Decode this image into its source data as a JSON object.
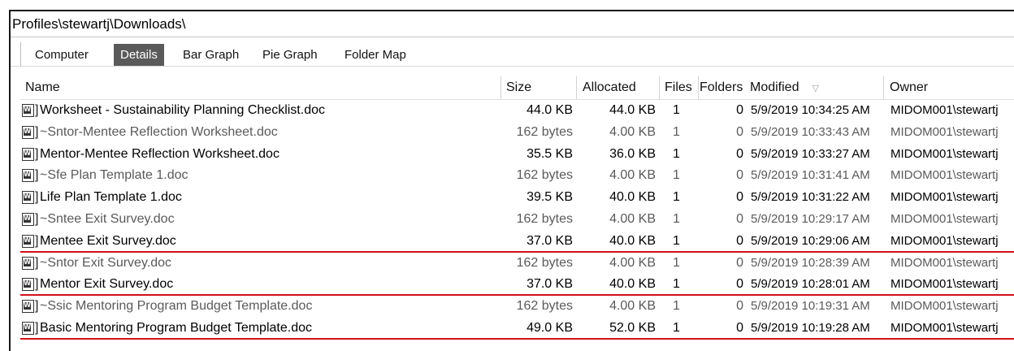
{
  "path": "Profiles\\stewartj\\Downloads\\",
  "tabs": [
    {
      "label": "Computer",
      "active": false
    },
    {
      "label": "Details",
      "active": true
    },
    {
      "label": "Bar Graph",
      "active": false
    },
    {
      "label": "Pie Graph",
      "active": false
    },
    {
      "label": "Folder Map",
      "active": false
    }
  ],
  "columns": {
    "name": "Name",
    "size": "Size",
    "allocated": "Allocated",
    "files": "Files",
    "folders": "Folders",
    "modified": "Modified",
    "owner": "Owner"
  },
  "sort_indicator": "▽",
  "rows": [
    {
      "name": "Worksheet - Sustainability Planning Checklist.doc",
      "size": "44.0 KB",
      "allocated": "44.0 KB",
      "files": "1",
      "folders": "0",
      "modified": "5/9/2019 10:34:25 AM",
      "owner": "MIDOM001\\stewartj",
      "temp": false
    },
    {
      "name": "~Sntor-Mentee Reflection Worksheet.doc",
      "size": "162 bytes",
      "allocated": "4.00 KB",
      "files": "1",
      "folders": "0",
      "modified": "5/9/2019 10:33:43 AM",
      "owner": "MIDOM001\\stewartj",
      "temp": true
    },
    {
      "name": "Mentor-Mentee Reflection Worksheet.doc",
      "size": "35.5 KB",
      "allocated": "36.0 KB",
      "files": "1",
      "folders": "0",
      "modified": "5/9/2019 10:33:27 AM",
      "owner": "MIDOM001\\stewartj",
      "temp": false
    },
    {
      "name": "~Sfe Plan Template 1.doc",
      "size": "162 bytes",
      "allocated": "4.00 KB",
      "files": "1",
      "folders": "0",
      "modified": "5/9/2019 10:31:41 AM",
      "owner": "MIDOM001\\stewartj",
      "temp": true
    },
    {
      "name": "Life Plan Template 1.doc",
      "size": "39.5 KB",
      "allocated": "40.0 KB",
      "files": "1",
      "folders": "0",
      "modified": "5/9/2019 10:31:22 AM",
      "owner": "MIDOM001\\stewartj",
      "temp": false
    },
    {
      "name": "~Sntee Exit Survey.doc",
      "size": "162 bytes",
      "allocated": "4.00 KB",
      "files": "1",
      "folders": "0",
      "modified": "5/9/2019 10:29:17 AM",
      "owner": "MIDOM001\\stewartj",
      "temp": true
    },
    {
      "name": "Mentee Exit Survey.doc",
      "size": "37.0 KB",
      "allocated": "40.0 KB",
      "files": "1",
      "folders": "0",
      "modified": "5/9/2019 10:29:06 AM",
      "owner": "MIDOM001\\stewartj",
      "temp": false
    },
    {
      "name": "~Sntor Exit Survey.doc",
      "size": "162 bytes",
      "allocated": "4.00 KB",
      "files": "1",
      "folders": "0",
      "modified": "5/9/2019 10:28:39 AM",
      "owner": "MIDOM001\\stewartj",
      "temp": true
    },
    {
      "name": "Mentor Exit Survey.doc",
      "size": "37.0 KB",
      "allocated": "40.0 KB",
      "files": "1",
      "folders": "0",
      "modified": "5/9/2019 10:28:01 AM",
      "owner": "MIDOM001\\stewartj",
      "temp": false
    },
    {
      "name": "~Ssic Mentoring Program Budget Template.doc",
      "size": "162 bytes",
      "allocated": "4.00 KB",
      "files": "1",
      "folders": "0",
      "modified": "5/9/2019 10:19:31 AM",
      "owner": "MIDOM001\\stewartj",
      "temp": true
    },
    {
      "name": "Basic Mentoring Program Budget Template.doc",
      "size": "49.0 KB",
      "allocated": "52.0 KB",
      "files": "1",
      "folders": "0",
      "modified": "5/9/2019 10:19:28 AM",
      "owner": "MIDOM001\\stewartj",
      "temp": false
    }
  ],
  "annotation_color": "#d0101a"
}
